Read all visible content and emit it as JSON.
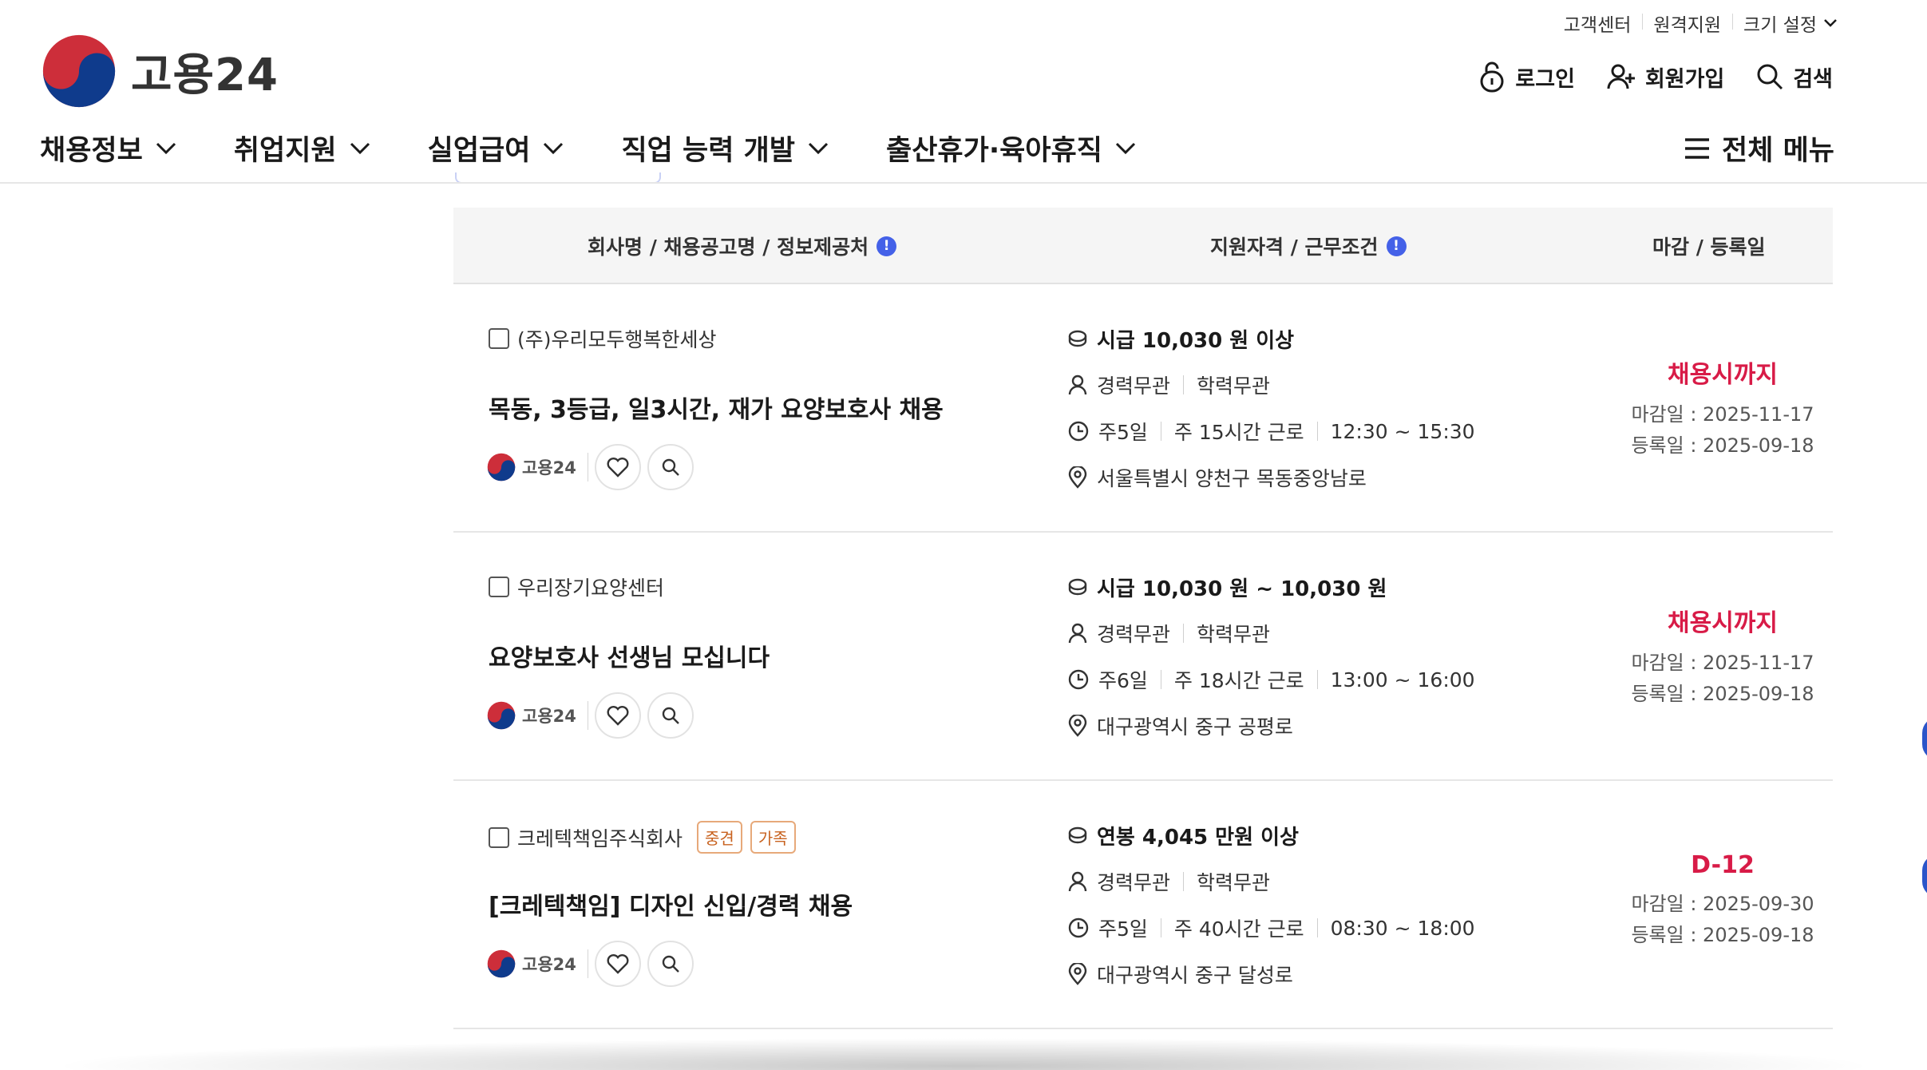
{
  "header": {
    "logo_text": "고용24",
    "util_links": [
      "고객센터",
      "원격지원",
      "크기 설정"
    ],
    "member": {
      "login": "로그인",
      "signup": "회원가입",
      "search": "검색"
    },
    "gnb": [
      "채용정보",
      "취업지원",
      "실업급여",
      "직업 능력 개발",
      "출산휴가·육아휴직"
    ],
    "all_menu": "전체 메뉴"
  },
  "table": {
    "headers": {
      "col1": "회사명 / 채용공고명 / 정보제공처",
      "col2": "지원자격 / 근무조건",
      "col3": "마감 / 등록일"
    },
    "rows": [
      {
        "company": "(주)우리모두행복한세상",
        "tags": [],
        "title": "목동, 3등급, 일3시간, 재가 요양보호사 채용",
        "source": "고용24",
        "pay": "시급 10,030 원 이상",
        "career": "경력무관",
        "education": "학력무관",
        "days": "주5일",
        "hours": "주 15시간 근로",
        "time": "12:30 ~ 15:30",
        "location": "서울특별시 양천구 목동중앙남로",
        "status": "채용시까지",
        "deadline": "마감일 : 2025-11-17",
        "registered": "등록일 : 2025-09-18"
      },
      {
        "company": "우리장기요양센터",
        "tags": [],
        "title": "요양보호사 선생님 모십니다",
        "source": "고용24",
        "pay": "시급 10,030 원 ~ 10,030 원",
        "career": "경력무관",
        "education": "학력무관",
        "days": "주6일",
        "hours": "주 18시간 근로",
        "time": "13:00 ~ 16:00",
        "location": "대구광역시 중구 공평로",
        "status": "채용시까지",
        "deadline": "마감일 : 2025-11-17",
        "registered": "등록일 : 2025-09-18"
      },
      {
        "company": "크레텍책임주식회사",
        "tags": [
          "중견",
          "가족"
        ],
        "title": "[크레텍책임] 디자인 신입/경력 채용",
        "source": "고용24",
        "pay": "연봉 4,045 만원 이상",
        "career": "경력무관",
        "education": "학력무관",
        "days": "주5일",
        "hours": "주 40시간 근로",
        "time": "08:30 ~ 18:00",
        "location": "대구광역시 중구 달성로",
        "status": "D-12",
        "deadline": "마감일 : 2025-09-30",
        "registered": "등록일 : 2025-09-18"
      }
    ]
  },
  "colors": {
    "accent_blue": "#4461e8",
    "status_red": "#d81b47",
    "tag_orange": "#c8621f",
    "logo_red": "#cd2e3a",
    "logo_blue": "#0f3b8c"
  },
  "icons": {
    "util_chevron": "chevron-down-icon",
    "login": "lock-icon",
    "signup": "user-plus-icon",
    "search": "search-icon",
    "menu": "hamburger-icon",
    "pay": "coin-icon",
    "person": "person-icon",
    "clock": "clock-icon",
    "location": "location-pin-icon",
    "bookmark": "heart-icon",
    "detail": "search-icon"
  }
}
